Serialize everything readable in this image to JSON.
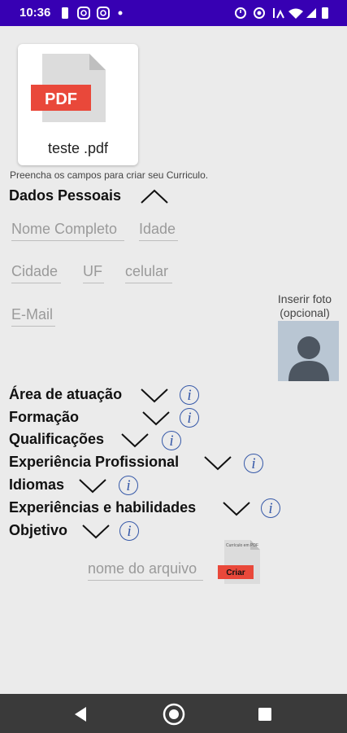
{
  "status": {
    "time": "10:36"
  },
  "file_card": {
    "icon_label": "PDF",
    "filename": "teste .pdf"
  },
  "hint": "Preencha os campos para criar seu Curriculo.",
  "personal": {
    "title": "Dados Pessoais",
    "fields": {
      "nome": "Nome Completo",
      "idade": "Idade",
      "cidade": "Cidade",
      "uf": "UF",
      "celular": "celular",
      "email": "E-Mail"
    }
  },
  "photo": {
    "label_line1": "Inserir foto",
    "label_line2": "(opcional)"
  },
  "sections": [
    {
      "label": "Área de atuação"
    },
    {
      "label": "Formação"
    },
    {
      "label": "Qualificações"
    },
    {
      "label": "Experiência Profissional"
    },
    {
      "label": "Idiomas"
    },
    {
      "label": "Experiências e habilidades"
    },
    {
      "label": "Objetivo"
    }
  ],
  "info_glyph": "i",
  "filename_field": {
    "placeholder": "nome do arquivo"
  },
  "create_button": {
    "caption": "Currículo em PDF",
    "label": "Criar"
  },
  "colors": {
    "status_bar": "#3700b3",
    "pdf_red": "#e9483a",
    "info_blue": "#3558a8",
    "nav_bar": "#3a3a3a"
  }
}
